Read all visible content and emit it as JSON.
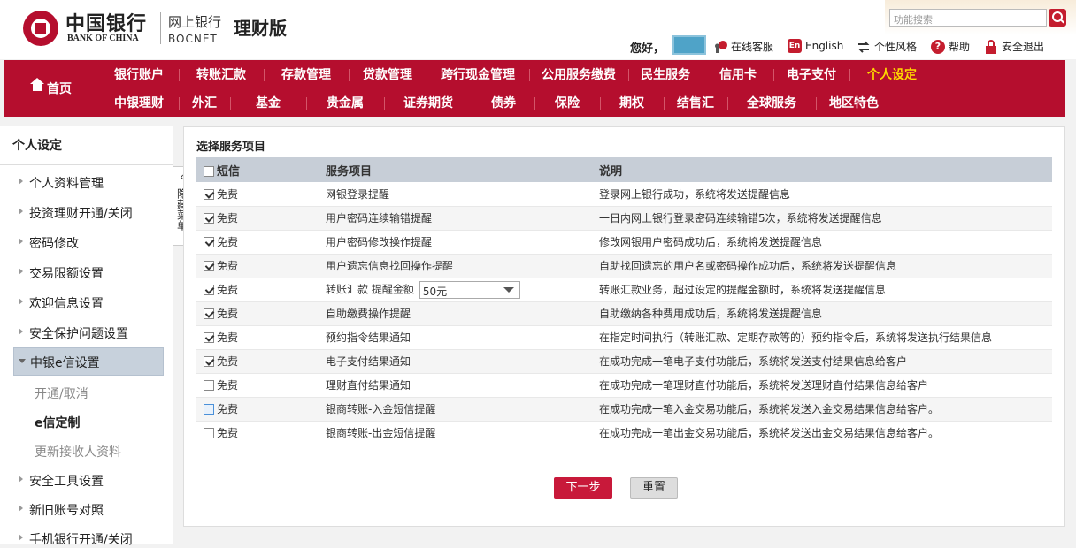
{
  "brand": {
    "cn": "中国银行",
    "en": "BANK OF CHINA",
    "ebank_cn": "网上银行",
    "ebank_en": "BOCNET",
    "edition": "理财版"
  },
  "search": {
    "placeholder": "功能搜索"
  },
  "topnav": {
    "greeting": "您好，",
    "service": "在线客服",
    "english": "English",
    "style": "个性风格",
    "help": "帮助",
    "logout": "安全退出"
  },
  "nav": {
    "home": "首页",
    "row1": [
      "银行账户",
      "转账汇款",
      "存款管理",
      "贷款管理",
      "跨行现金管理",
      "公用服务缴费",
      "民生服务",
      "信用卡",
      "电子支付",
      "个人设定"
    ],
    "row2": [
      "中银理财",
      "外汇",
      "基金",
      "贵金属",
      "证券期货",
      "债券",
      "保险",
      "期权",
      "结售汇",
      "全球服务",
      "地区特色"
    ]
  },
  "sidebar": {
    "title": "个人设定",
    "items": [
      "个人资料管理",
      "投资理财开通/关闭",
      "密码修改",
      "交易限额设置",
      "欢迎信息设置",
      "安全保护问题设置"
    ],
    "active": "中银e信设置",
    "subitems": [
      "开通/取消",
      "e信定制",
      "更新接收人资料"
    ],
    "items_after": [
      "安全工具设置",
      "新旧账号对照",
      "手机银行开通/关闭"
    ]
  },
  "hide_tab": {
    "label": "隐藏菜单"
  },
  "main": {
    "title": "选择服务项目",
    "headers": {
      "sms": "短信",
      "service": "服务项目",
      "desc": "说明"
    },
    "rows": [
      {
        "fee": "免费",
        "checked": true,
        "service": "网银登录提醒",
        "desc": "登录网上银行成功，系统将发送提醒信息"
      },
      {
        "fee": "免费",
        "checked": true,
        "service": "用户密码连续输错提醒",
        "desc": "一日内网上银行登录密码连续输错5次，系统将发送提醒信息"
      },
      {
        "fee": "免费",
        "checked": true,
        "service": "用户密码修改操作提醒",
        "desc": "修改网银用户密码成功后，系统将发送提醒信息"
      },
      {
        "fee": "免费",
        "checked": true,
        "service": "用户遗忘信息找回操作提醒",
        "desc": "自助找回遗忘的用户名或密码操作成功后，系统将发送提醒信息"
      },
      {
        "fee": "免费",
        "checked": true,
        "service": "转账汇款 提醒金额",
        "select": "50元",
        "desc": "转账汇款业务，超过设定的提醒金额时，系统将发送提醒信息"
      },
      {
        "fee": "免费",
        "checked": true,
        "service": "自助缴费操作提醒",
        "desc": "自助缴纳各种费用成功后，系统将发送提醒信息"
      },
      {
        "fee": "免费",
        "checked": true,
        "service": "预约指令结果通知",
        "desc": "在指定时间执行（转账汇款、定期存款等的）预约指令后，系统将发送执行结果信息"
      },
      {
        "fee": "免费",
        "checked": true,
        "service": "电子支付结果通知",
        "desc": "在成功完成一笔电子支付功能后，系统将发送支付结果信息给客户"
      },
      {
        "fee": "免费",
        "checked": false,
        "service": "理财直付结果通知",
        "desc": "在成功完成一笔理财直付功能后，系统将发送理财直付结果信息给客户"
      },
      {
        "fee": "免费",
        "checked": false,
        "hover": true,
        "service": "银商转账-入金短信提醒",
        "desc": "在成功完成一笔入金交易功能后，系统将发送入金交易结果信息给客户。"
      },
      {
        "fee": "免费",
        "checked": false,
        "service": "银商转账-出金短信提醒",
        "desc": "在成功完成一笔出金交易功能后，系统将发送出金交易结果信息给客户。"
      }
    ],
    "btn_next": "下一步",
    "btn_reset": "重置"
  },
  "colors": {
    "brand_red": "#b50e2e",
    "active_nav": "#ffd800",
    "header_row": "#c7ced7"
  }
}
